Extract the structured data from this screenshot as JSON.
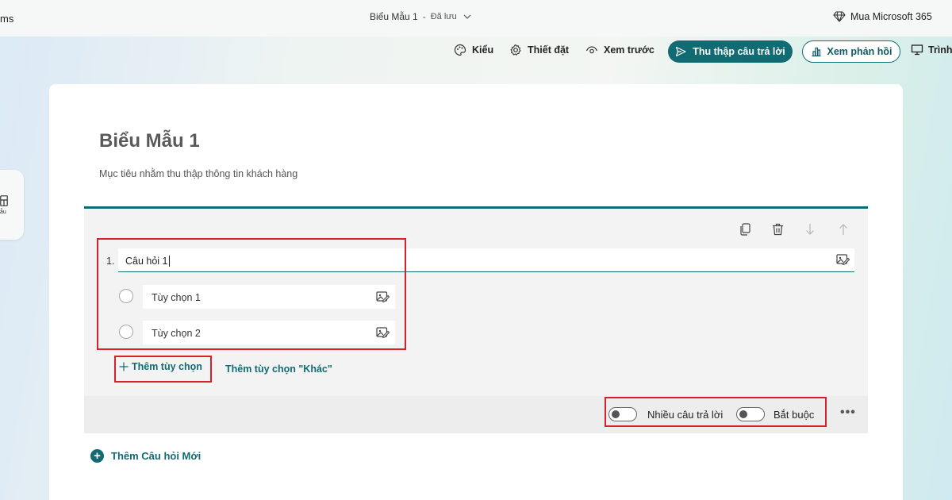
{
  "app": {
    "name_fragment": "ms"
  },
  "header": {
    "doc_title": "Biểu Mẫu 1",
    "separator": "-",
    "saved_status": "Đã lưu",
    "buy_label": "Mua Microsoft 365"
  },
  "toolbar": {
    "style_label": "Kiểu",
    "settings_label": "Thiết đặt",
    "preview_label": "Xem trước",
    "collect_label": "Thu thập câu trả lời",
    "responses_label": "Xem phản hồi",
    "present_label": "Trình"
  },
  "left_rail": {
    "label_fragment": "ẫu"
  },
  "form": {
    "title": "Biểu Mẫu 1",
    "description": "Mục tiêu nhằm thu thập thông tin khách hàng"
  },
  "question": {
    "number": "1.",
    "text": "Câu hỏi 1",
    "options": [
      {
        "label": "Tùy chọn 1"
      },
      {
        "label": "Tùy chọn 2"
      }
    ],
    "add_option_label": "Thêm tùy chọn",
    "add_other_label": "Thêm tùy chọn \"Khác\"",
    "multiple_answers_label": "Nhiều câu trả lời",
    "multiple_answers_on": false,
    "required_label": "Bắt buộc",
    "required_on": false
  },
  "add_question_label": "Thêm Câu hỏi Mới",
  "colors": {
    "accent": "#106b73",
    "highlight": "#d8202a"
  }
}
